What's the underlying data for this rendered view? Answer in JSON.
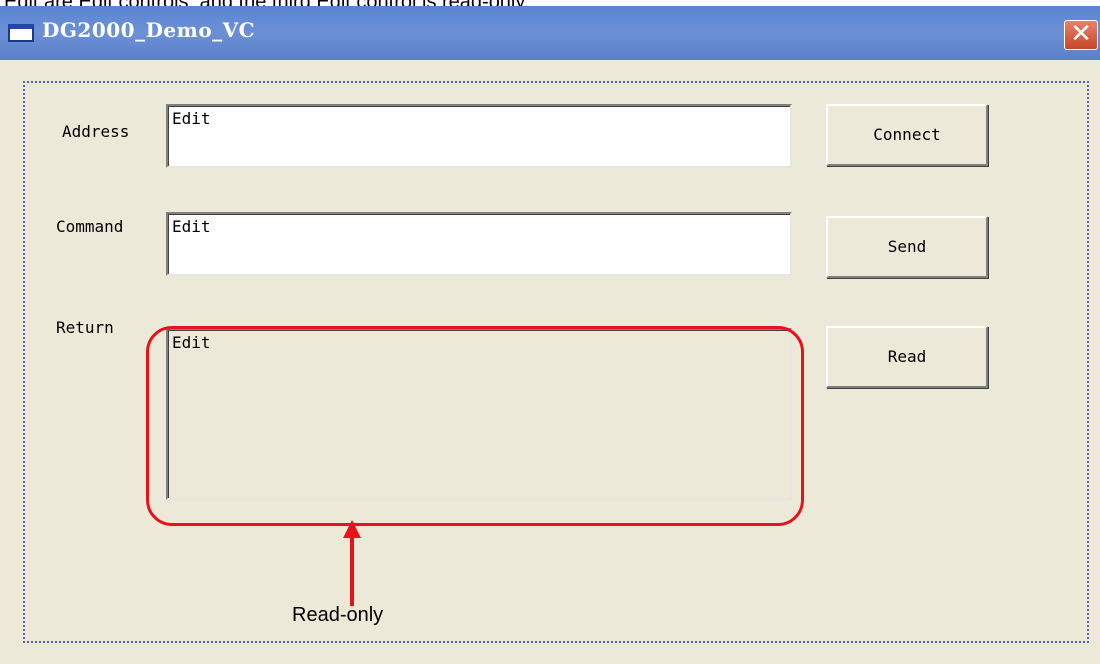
{
  "caption": {
    "text": "Edit are Edit controls, and the third Edit control is read-only."
  },
  "window": {
    "title": "DG2000_Demo_VC",
    "close_symbol": "✕",
    "icon": "window-icon"
  },
  "form": {
    "address": {
      "label": "Address",
      "value": "Edit",
      "button": "Connect"
    },
    "command": {
      "label": "Command",
      "value": "Edit",
      "button": "Send"
    },
    "return": {
      "label": "Return",
      "value": "Edit",
      "button": "Read",
      "readonly": true
    }
  },
  "annotation": {
    "label": "Read-only",
    "color": "#e8121a"
  },
  "colors": {
    "titlebar": "#6c90d6",
    "dialog_bg": "#ece9d8",
    "close_button": "#c8452a",
    "focus_border": "#4b63c8"
  }
}
